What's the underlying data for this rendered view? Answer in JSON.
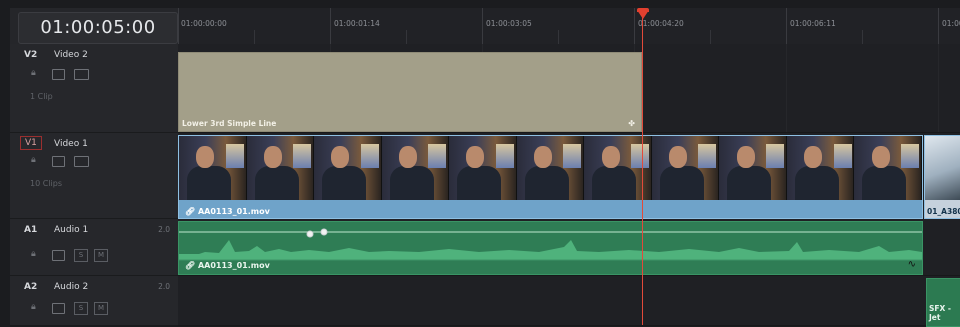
{
  "timecode": "01:00:05:00",
  "ruler": {
    "labels": [
      "01:00:00:00",
      "01:00:01:14",
      "01:00:03:05",
      "01:00:04:20",
      "01:00:06:11",
      "01:00:0"
    ]
  },
  "tracks": {
    "v2": {
      "id": "V2",
      "name": "Video 2",
      "count": "1 Clip"
    },
    "v1": {
      "id": "V1",
      "name": "Video 1",
      "count": "10 Clips"
    },
    "a1": {
      "id": "A1",
      "name": "Audio 1",
      "channels": "2.0"
    },
    "a2": {
      "id": "A2",
      "name": "Audio 2",
      "channels": "2.0"
    }
  },
  "clips": {
    "lower3": "Lower 3rd Simple Line",
    "video1": "AA0113_01.mov",
    "video1b": "01_A380",
    "audio1": "AA0113_01.mov",
    "audio2": "SFX - Jet"
  },
  "buttons": {
    "solo": "S",
    "mute": "M"
  },
  "colors": {
    "video": "#6fa3c9",
    "audio": "#2f7d55",
    "title": "#a39f89",
    "playhead": "#e2402f"
  },
  "icons": [
    "lock-icon",
    "auto-track-icon",
    "monitor-icon",
    "solo-icon",
    "mute-icon",
    "link-icon",
    "playhead-icon"
  ]
}
